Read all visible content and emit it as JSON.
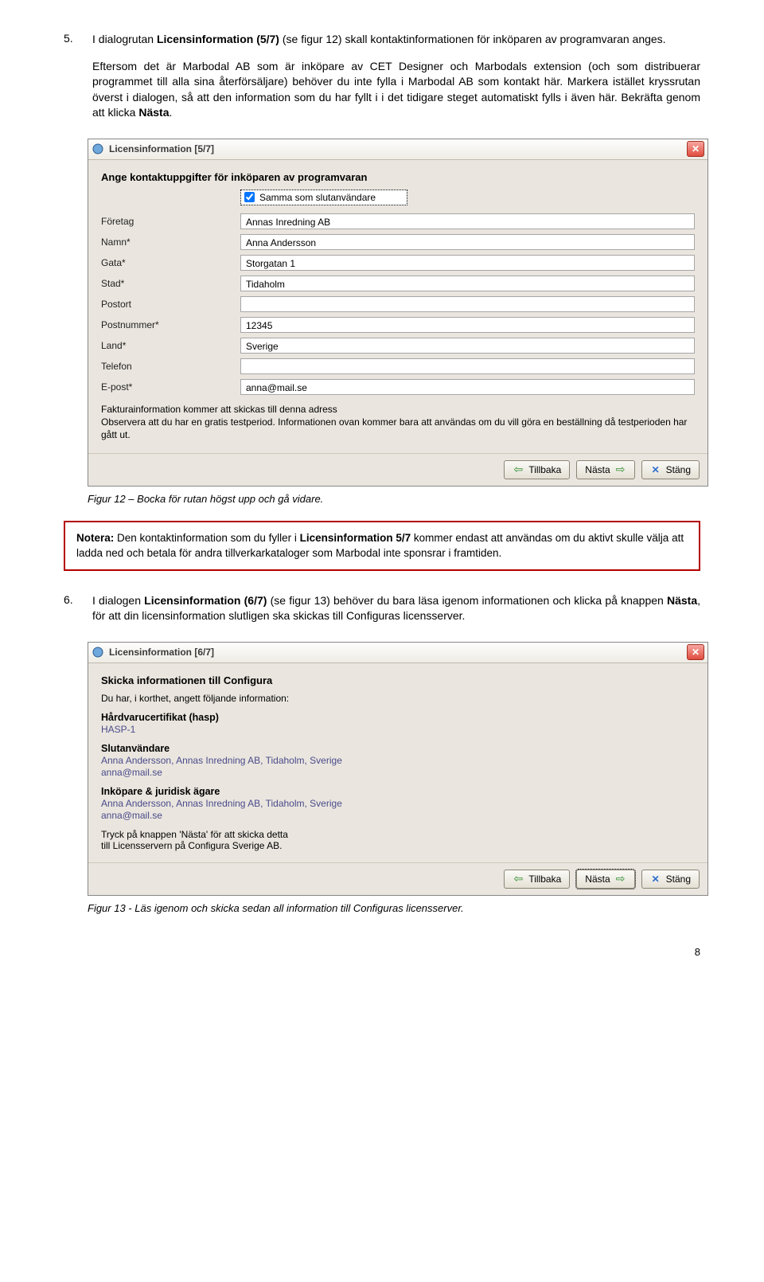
{
  "section5": {
    "num": "5.",
    "para1_a": "I dialogrutan ",
    "para1_b": "Licensinformation (5/7)",
    "para1_c": " (se figur 12) skall kontaktinformationen för inköparen av programvaran anges.",
    "para2_a": "Eftersom det är Marbodal AB som är inköpare av CET Designer och Marbodals extension (och som distribuerar programmet till alla sina återförsäljare) behöver du inte fylla i Marbodal AB som kontakt här. Markera istället kryssrutan överst i dialogen, så att den information som du har fyllt i i det tidigare steget automatiskt fylls i även här. Bekräfta genom att klicka ",
    "para2_b": "Nästa",
    "para2_c": "."
  },
  "dlg5": {
    "title": "Licensinformation [5/7]",
    "heading": "Ange kontaktuppgifter för inköparen av programvaran",
    "chk_label": "Samma som slutanvändare",
    "rows": [
      {
        "label": "Företag",
        "value": "Annas Inredning AB"
      },
      {
        "label": "Namn*",
        "value": "Anna Andersson"
      },
      {
        "label": "Gata*",
        "value": "Storgatan 1"
      },
      {
        "label": "Stad*",
        "value": "Tidaholm"
      },
      {
        "label": "Postort",
        "value": ""
      },
      {
        "label": "Postnummer*",
        "value": "12345"
      },
      {
        "label": "Land*",
        "value": "Sverige"
      },
      {
        "label": "Telefon",
        "value": ""
      },
      {
        "label": "E-post*",
        "value": "anna@mail.se"
      }
    ],
    "note1": "Fakturainformation kommer att skickas till denna adress",
    "note2": "Observera att du har en gratis testperiod. Informationen ovan kommer bara att användas om du vill göra en beställning då testperioden har gått ut.",
    "btn_back": "Tillbaka",
    "btn_next": "Nästa",
    "btn_close": "Stäng"
  },
  "caption12": "Figur 12 – Bocka för rutan högst upp och gå vidare.",
  "notebox": {
    "lead": "Notera:",
    "body_a": " Den kontaktinformation som du fyller i ",
    "body_b": "Licensinformation 5/7",
    "body_c": " kommer endast att användas om du aktivt skulle välja att ladda ned och betala för andra tillverkarkataloger som Marbodal inte sponsrar i framtiden."
  },
  "section6": {
    "num": "6.",
    "para_a": "I dialogen ",
    "para_b": "Licensinformation (6/7)",
    "para_c": " (se figur 13) behöver du bara läsa igenom informationen och klicka på knappen ",
    "para_d": "Nästa",
    "para_e": ", för att din licensinformation slutligen ska skickas till Configuras licensserver."
  },
  "dlg6": {
    "title": "Licensinformation [6/7]",
    "heading": "Skicka informationen till Configura",
    "intro": "Du har, i korthet, angett följande information:",
    "h1": "Hårdvarucertifikat (hasp)",
    "v1": "HASP-1",
    "h2": "Slutanvändare",
    "v2a": "Anna Andersson, Annas Inredning AB, Tidaholm, Sverige",
    "v2b": "anna@mail.se",
    "h3": "Inköpare & juridisk ägare",
    "v3a": "Anna Andersson, Annas Inredning AB, Tidaholm, Sverige",
    "v3b": "anna@mail.se",
    "foot1": "Tryck på knappen 'Nästa' för att skicka detta",
    "foot2": "till Licensservern på Configura Sverige AB.",
    "btn_back": "Tillbaka",
    "btn_next": "Nästa",
    "btn_close": "Stäng"
  },
  "caption13": "Figur 13 - Läs igenom och skicka sedan all information till Configuras licensserver.",
  "pagenum": "8"
}
